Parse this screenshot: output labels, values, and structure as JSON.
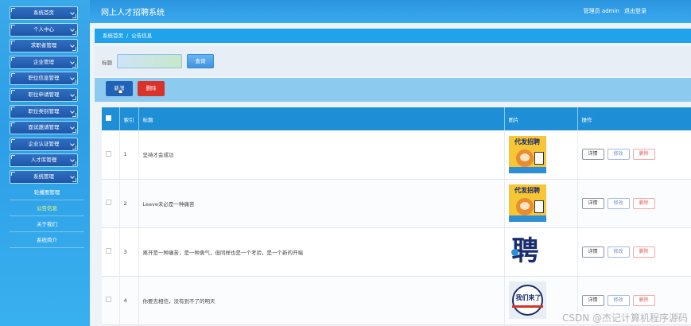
{
  "app": {
    "title": "网上人才招聘系统"
  },
  "header": {
    "user_label": "管理员 admin",
    "logout": "退出登录"
  },
  "sidebar": {
    "items": [
      {
        "label": "系统首页"
      },
      {
        "label": "个人中心"
      },
      {
        "label": "求职者管理"
      },
      {
        "label": "企业管理"
      },
      {
        "label": "职位信息管理"
      },
      {
        "label": "职位申请管理"
      },
      {
        "label": "职位类别管理"
      },
      {
        "label": "面试邀请管理"
      },
      {
        "label": "企业认证管理"
      },
      {
        "label": "人才库管理"
      },
      {
        "label": "系统管理"
      }
    ],
    "subitems": [
      {
        "label": "轮播图管理"
      },
      {
        "label": "公告信息",
        "active": true
      },
      {
        "label": "关于我们"
      },
      {
        "label": "系统简介"
      }
    ]
  },
  "breadcrumb": {
    "home": "系统首页",
    "separator": "/",
    "current": "公告信息"
  },
  "search": {
    "label": "标题",
    "value": "",
    "placeholder": "",
    "button": "查询"
  },
  "actions": {
    "add": "新增",
    "delete": "删除"
  },
  "table": {
    "headers": {
      "index": "索引",
      "title": "标题",
      "image": "图片",
      "ops": "操作"
    },
    "rows": [
      {
        "index": "1",
        "title": "坚持才会成功",
        "image": "recruit"
      },
      {
        "index": "2",
        "title": "Leave未必是一种痛苦",
        "image": "recruit"
      },
      {
        "index": "3",
        "title": "离开是一种痛苦，是一种勇气，但同样也是一个考验，是一个新的开端",
        "image": "pin"
      },
      {
        "index": "4",
        "title": "你要去相信，没有到不了的明天",
        "image": "come"
      }
    ],
    "ops": {
      "detail": "详情",
      "edit": "修改",
      "delete": "删除"
    },
    "thumb_text": {
      "recruit": "代发招聘",
      "pin": "聘",
      "come": "我们来了"
    }
  },
  "watermark": "CSDN @杰记计算机程序源码",
  "colors": {
    "accent": "#21a3ec",
    "header": "#2b95df",
    "danger": "#d9322b",
    "primary": "#1f62b8"
  },
  "icons": {
    "cursor": "hand-pointer-icon",
    "checkbox": "checkbox-icon"
  }
}
